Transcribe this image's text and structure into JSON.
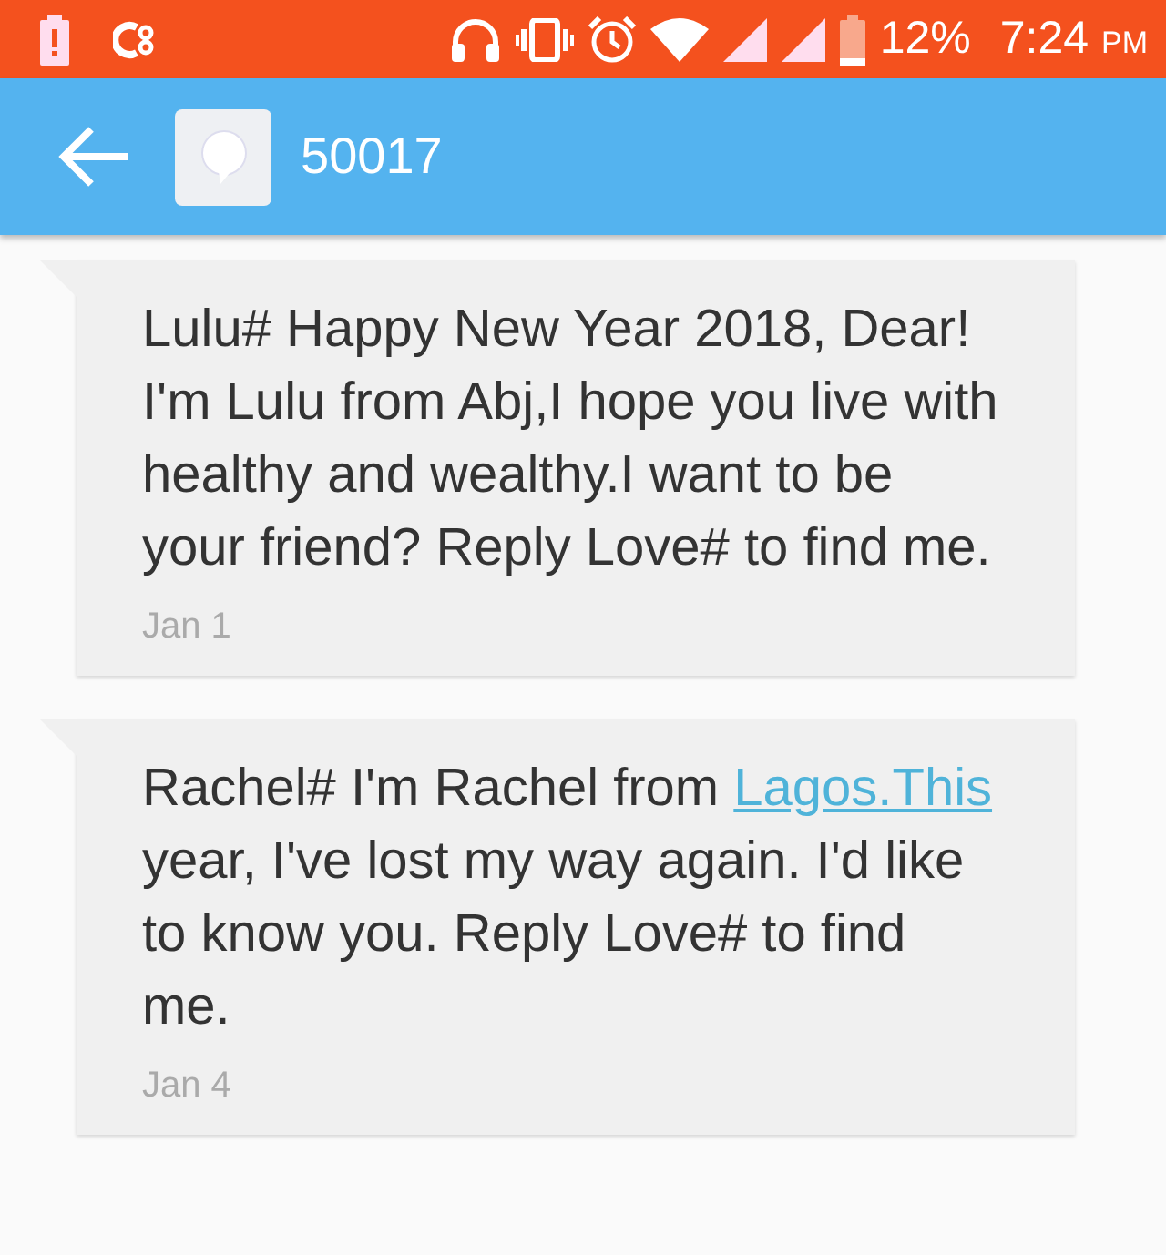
{
  "status_bar": {
    "battery_percent": "12%",
    "time": "7:24",
    "period": "PM"
  },
  "header": {
    "title": "50017"
  },
  "messages": [
    {
      "segments": [
        {
          "text": "Lulu# Happy New Year 2018, Dear! I'm Lulu from Abj,I hope you live with healthy and wealthy.I want to be your friend? Reply Love# to find me.",
          "link": false
        }
      ],
      "date": "Jan 1"
    },
    {
      "segments": [
        {
          "text": "Rachel# I'm Rachel from ",
          "link": false
        },
        {
          "text": "Lagos.This",
          "link": true
        },
        {
          "text": " year, I've lost my way again. I'd like to know you. Reply Love# to find me.",
          "link": false
        }
      ],
      "date": "Jan 4"
    }
  ]
}
